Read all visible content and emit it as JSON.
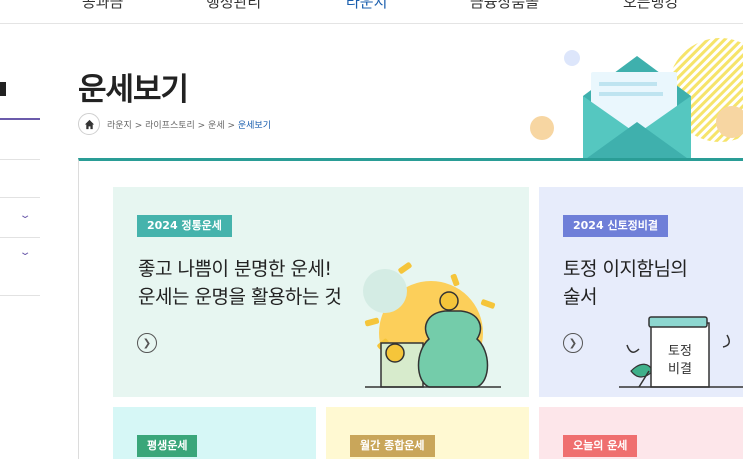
{
  "nav": {
    "items": [
      "공과금",
      "행정관리",
      "라운지",
      "금융상품몰",
      "오픈뱅킹"
    ],
    "active": "라운지"
  },
  "page": {
    "title": "운세보기"
  },
  "breadcrumb": {
    "path": "라운지 > 라이프스토리 > 운세 > ",
    "current": "운세보기"
  },
  "cards": [
    {
      "badge": "2024 정통운세",
      "desc": "좋고 나쁨이 분명한 운세!\n운세는 운명을 활용하는 것",
      "badge_color": "#45b3ac",
      "bg": "#e7f6f1"
    },
    {
      "badge": "2024 신토정비결",
      "desc": "토정 이지함님의\n술서",
      "badge_color": "#6f7fd8",
      "bg": "#e7ecfb",
      "illustration_text": "토정\n비결"
    },
    {
      "badge": "평생운세",
      "badge_color": "#3aa67a",
      "bg": "#d6f7f6"
    },
    {
      "badge": "월간 종합운세",
      "badge_color": "#c9a65a",
      "bg": "#fff9d2"
    },
    {
      "badge": "오늘의 운세",
      "badge_color": "#ef6f6f",
      "bg": "#fde6ea"
    }
  ],
  "icons": {
    "home": "home-icon",
    "more": "arrow-circle-icon",
    "chevron": "chevron-down-icon"
  },
  "colors": {
    "accent": "#2a9d96",
    "nav_active": "#1b5fae",
    "sidebar_accent": "#6b5bab"
  }
}
